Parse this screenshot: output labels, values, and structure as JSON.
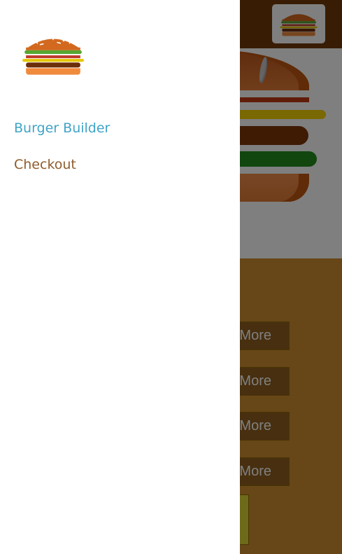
{
  "app": {
    "toolbar": {
      "logo": "burger-logo-icon"
    },
    "controls": {
      "more_buttons": [
        {
          "label": "More"
        },
        {
          "label": "More"
        },
        {
          "label": "More"
        },
        {
          "label": "More"
        }
      ]
    }
  },
  "drawer": {
    "logo": "burger-logo-icon",
    "nav": [
      {
        "label": "Burger Builder",
        "active": true
      },
      {
        "label": "Checkout",
        "active": false
      }
    ]
  },
  "colors": {
    "toolbar": "#703b09",
    "controls_bg": "#cf8f2e",
    "active_link": "#40a4c8",
    "link": "#8f5c2c"
  }
}
